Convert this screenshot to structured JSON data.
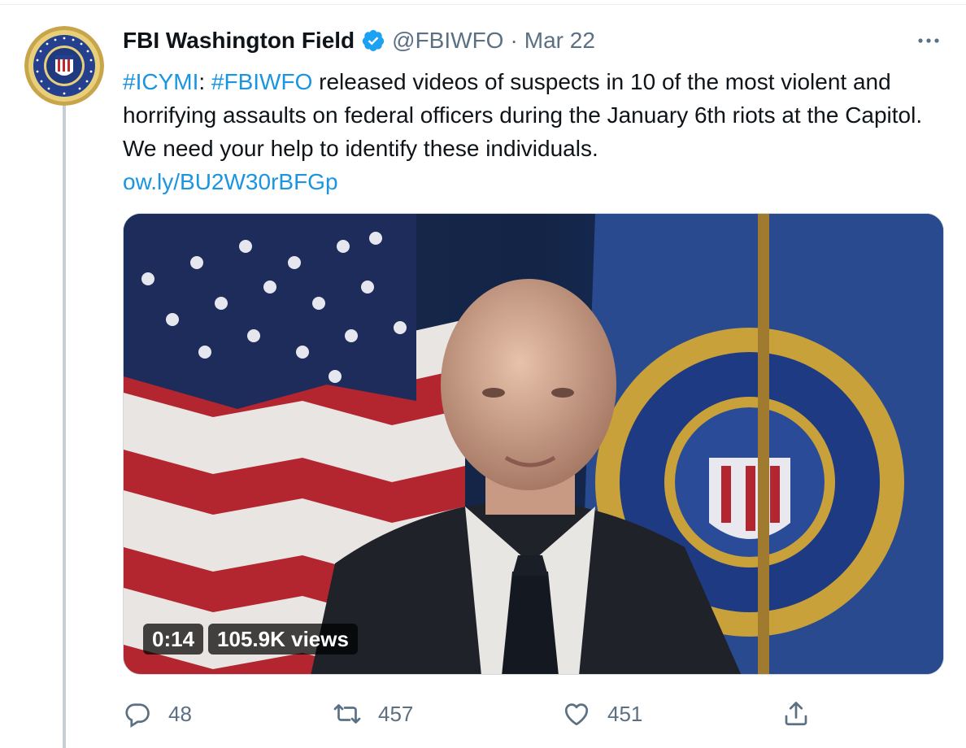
{
  "tweet": {
    "display_name": "FBI Washington Field",
    "handle": "@FBIWFO",
    "separator": "·",
    "date": "Mar 22",
    "text_parts": {
      "hashtag_1": "#ICYMI",
      "after_hashtag_1": ": ",
      "hashtag_2": "#FBIWFO",
      "body": " released videos of suspects in 10 of the most violent and horrifying assaults on federal officers during the January 6th riots at the Capitol. We need your help to identify these individuals.",
      "link": "ow.ly/BU2W30rBFGp"
    },
    "video": {
      "duration": "0:14",
      "views": "105.9K views"
    },
    "actions": {
      "replies": "48",
      "retweets": "457",
      "likes": "451"
    }
  },
  "icons": {
    "avatar": "fbi-seal",
    "verified": "verified-badge-icon",
    "more": "more-icon",
    "reply": "reply-icon",
    "retweet": "retweet-icon",
    "like": "heart-icon",
    "share": "share-icon"
  },
  "colors": {
    "link": "#1b95e0",
    "secondary_text": "#5b7083",
    "verified": "#1da1f2"
  }
}
